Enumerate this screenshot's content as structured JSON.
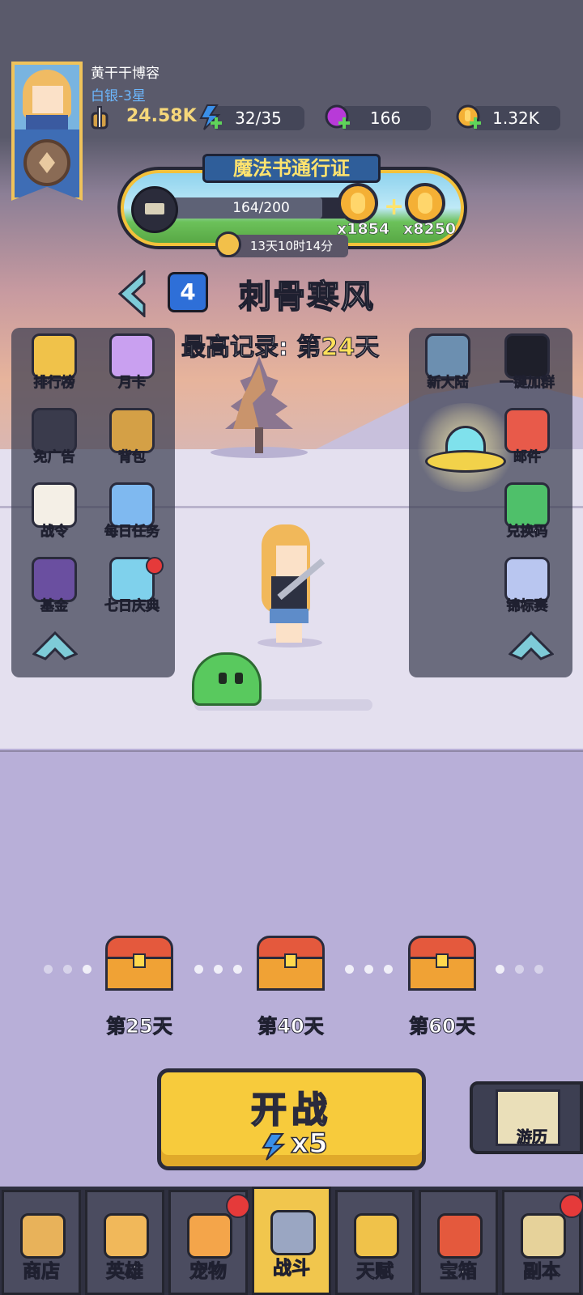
{
  "player": {
    "name": "黄干干博容",
    "rank": "白银-3星"
  },
  "resources": {
    "power": "24.58K",
    "energy": "32/35",
    "gems": "166",
    "coins": "1.32K"
  },
  "pass": {
    "title": "魔法书通行证",
    "progress_text": "164/200",
    "progress_fraction": 0.82,
    "reward1_count": "x1854",
    "reward2_count": "x8250",
    "plus": "+",
    "timer": "13天10时14分"
  },
  "stage": {
    "number": "4",
    "name": "刺骨寒风",
    "record_prefix": "最高记录: 第",
    "record_day": "24",
    "record_suffix": "天"
  },
  "left_panel": [
    {
      "label": "排行榜",
      "icon": "leaderboard-icon",
      "color": "#f0c24a"
    },
    {
      "label": "月卡",
      "icon": "monthly-card-icon",
      "color": "#c9a0f0"
    },
    {
      "label": "免广告",
      "icon": "no-ads-icon",
      "color": "#3a3b4c"
    },
    {
      "label": "背包",
      "icon": "backpack-icon",
      "color": "#d4a046"
    },
    {
      "label": "战令",
      "icon": "battle-pass-icon",
      "color": "#f4efe6"
    },
    {
      "label": "每日任务",
      "icon": "daily-task-icon",
      "color": "#7fb9f0"
    },
    {
      "label": "基金",
      "icon": "fund-icon",
      "color": "#6a4fa0"
    },
    {
      "label": "七日庆典",
      "icon": "seven-day-gift-icon",
      "color": "#7fd1ec"
    }
  ],
  "right_panel": [
    {
      "label": "新大陆",
      "icon": "new-continent-icon",
      "color": "#6c8fb0"
    },
    {
      "label": "一键加群",
      "icon": "qq-group-icon",
      "color": "#1e1f2a"
    },
    {
      "label": "邮件",
      "icon": "mail-icon",
      "color": "#e85a4a"
    },
    {
      "label": "兑换码",
      "icon": "redeem-code-icon",
      "color": "#4fc06a"
    },
    {
      "label": "锦标赛",
      "icon": "tournament-icon",
      "color": "#b9c6f0"
    }
  ],
  "milestones": [
    {
      "label": "第25天"
    },
    {
      "label": "第40天"
    },
    {
      "label": "第60天"
    }
  ],
  "start": {
    "label": "开战",
    "cost": "x5"
  },
  "travel": {
    "label": "游历"
  },
  "nav": [
    {
      "label": "商店",
      "icon": "shop-icon",
      "color": "#e8b25a",
      "badge": false
    },
    {
      "label": "英雄",
      "icon": "hero-icon",
      "color": "#f1b85a",
      "badge": false
    },
    {
      "label": "宠物",
      "icon": "pet-icon",
      "color": "#f4a54a",
      "badge": true
    },
    {
      "label": "战斗",
      "icon": "battle-swords-icon",
      "color": "#9aa6c2",
      "badge": false
    },
    {
      "label": "天赋",
      "icon": "talent-icon",
      "color": "#f0c24a",
      "badge": false
    },
    {
      "label": "宝箱",
      "icon": "treasure-chest-icon",
      "color": "#e4593d",
      "badge": false
    },
    {
      "label": "副本",
      "icon": "dungeon-map-icon",
      "color": "#e6d29a",
      "badge": true
    }
  ],
  "colors": {
    "accent_yellow": "#f7cb3c",
    "rank_blue": "#6cb8ff",
    "badge_red": "#e53a3a"
  }
}
